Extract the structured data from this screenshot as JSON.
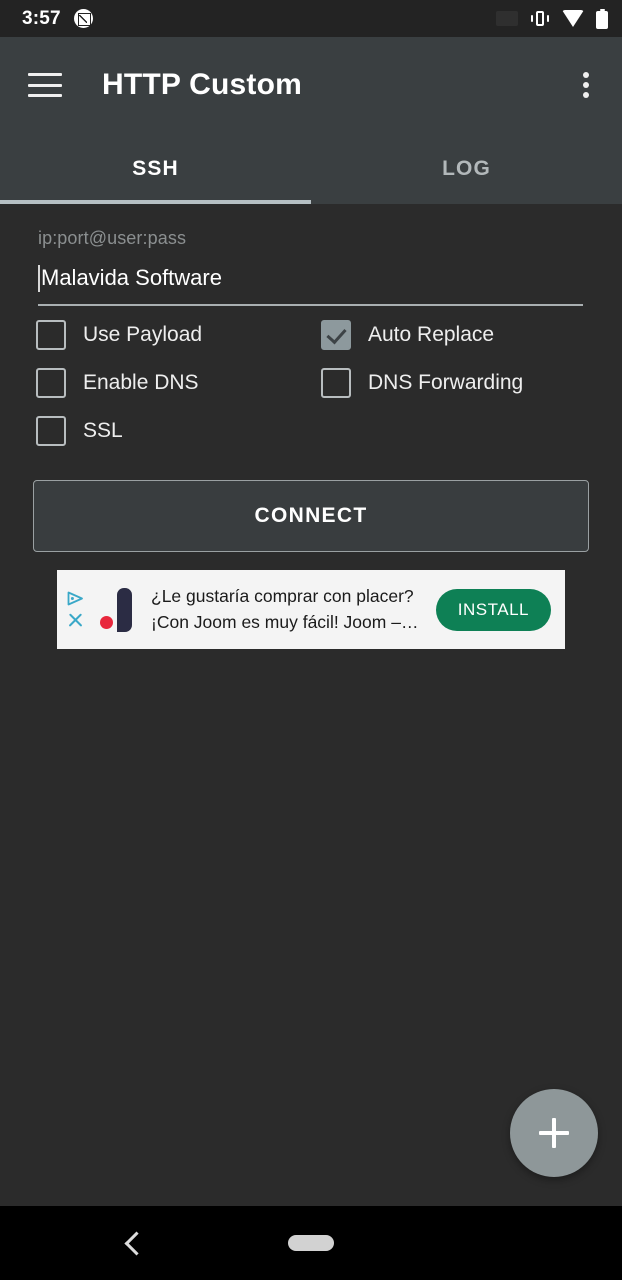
{
  "statusbar": {
    "time": "3:57",
    "icons": [
      "screenshot-icon",
      "ghost-app-icon",
      "vibrate-icon",
      "wifi-icon",
      "battery-icon"
    ]
  },
  "appbar": {
    "menu_icon": "hamburger-menu-icon",
    "title": "HTTP Custom",
    "overflow_icon": "overflow-menu-icon"
  },
  "tabs": {
    "items": [
      {
        "label": "SSH",
        "active": true
      },
      {
        "label": "LOG",
        "active": false
      }
    ]
  },
  "form": {
    "field": {
      "label": "ip:port@user:pass",
      "value": "Malavida Software",
      "placeholder": "ip:port@user:pass"
    },
    "checkboxes": [
      {
        "label": "Use Payload",
        "checked": false
      },
      {
        "label": "Auto Replace",
        "checked": true
      },
      {
        "label": "Enable DNS",
        "checked": false
      },
      {
        "label": "DNS Forwarding",
        "checked": false
      },
      {
        "label": "SSL",
        "checked": false
      }
    ],
    "connect_button": "CONNECT"
  },
  "ad": {
    "adchoices_icon": "adchoices-icon",
    "close_icon": "close-icon",
    "brand_logo": "joom-logo",
    "line1": "¿Le gustaría comprar con placer?",
    "line2": "¡Con Joom es muy fácil! Joom –…",
    "cta": "INSTALL",
    "cta_color": "#0e8055",
    "background": "#f4f4f4"
  },
  "fab": {
    "icon": "plus-icon"
  },
  "navbar": {
    "back_icon": "back-chevron-icon",
    "home_icon": "home-pill-icon"
  },
  "colors": {
    "screen_background": "#2b2b2b",
    "appbar": "#3a3f41",
    "statusbar": "#232323",
    "tab_indicator": "#b6c0c4",
    "accent_checked": "#8d999d"
  }
}
